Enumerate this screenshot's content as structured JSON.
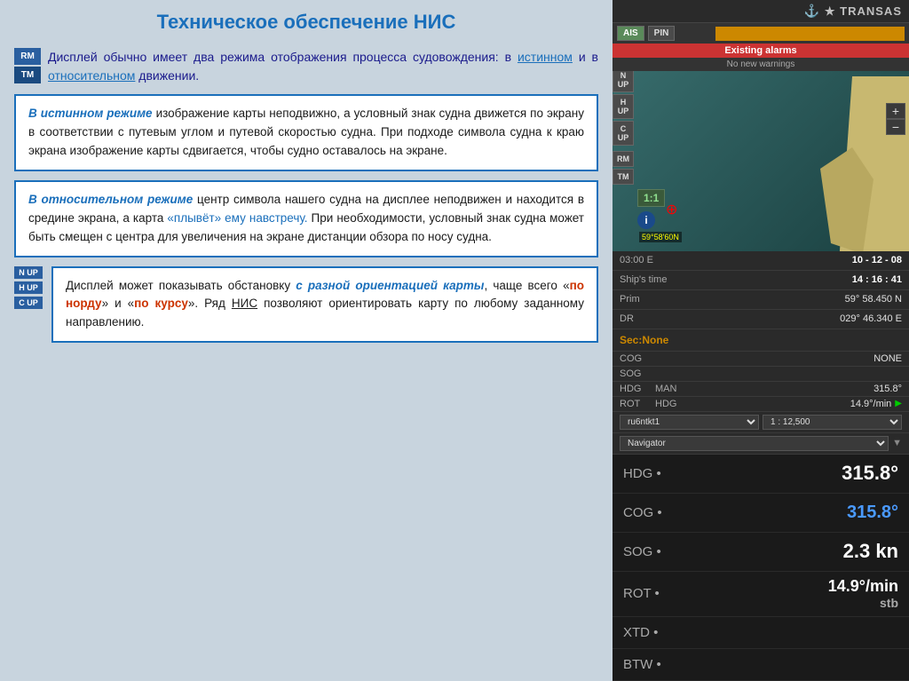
{
  "left": {
    "title": "Техническое обеспечение НИС",
    "intro": {
      "rm_label": "RM",
      "tm_label": "TM",
      "text_part1": "Дисплей обычно имеет два режима отображения процесса судовождения: в ",
      "link1": "истинном",
      "text_part2": " и в ",
      "link2": "относительном",
      "text_part3": " движении."
    },
    "box1": {
      "highlight": "В истинном режиме",
      "text": " изображение карты неподвижно, а условный знак судна движется по экрану в соответствии с путевым углом и путевой скоростью судна. При подходе символа судна к краю экрана изображение карты сдвигается, чтобы судно оставалось на экране."
    },
    "box2": {
      "highlight": "В относительном режиме",
      "text1": " центр символа нашего судна на дисплее неподвижен и находится в средине экрана, а карта ",
      "link": "«плывёт» ему навстречу.",
      "text2": " При необходимости, условный знак судна может быть смещен с центра для увеличения на экране дистанции обзора по носу судна."
    },
    "bottom": {
      "n_label": "N UP",
      "h_label": "H UP",
      "c_label": "C UP",
      "text_intro": "Дисплей может показывать обстановку ",
      "highlight1": "с разной ориентацией карты",
      "text2": ", чаще всего «",
      "link1": "по норду",
      "text3": "» и «",
      "link2": "по курсу",
      "text4": "». Ряд ",
      "underline1": "НИС",
      "text5": " позволяют ориентировать карту по любому заданному направлению."
    }
  },
  "right": {
    "logo": "★ TRANSAS",
    "controls": {
      "ais": "AIS",
      "pin": "PIN",
      "status_bar": "Existing alarms",
      "warning": "No new warnings"
    },
    "nav_side": [
      "▲",
      "N UP",
      "H UP",
      "C UP",
      "RM",
      "TM"
    ],
    "time": {
      "utc_label": "03:00 E",
      "date": "10 - 12 - 08",
      "ships_time_label": "Ship's time",
      "ships_time": "14 : 16 : 41"
    },
    "position": {
      "prim_label": "Prim",
      "prim_value": "59° 58.450 N",
      "dr_label": "DR",
      "dr_value": "029° 46.340 E"
    },
    "sec_none": "Sec:None",
    "cog_label": "COG",
    "cog_value": "NONE",
    "sog_label": "SOG",
    "hdg_label": "HDG",
    "hdg_mode": "MAN",
    "hdg_value": "315.8°",
    "rot_label": "ROT",
    "rot_mode": "HDG",
    "rot_value": "14.9°/min",
    "chart_id": "ru6ntkt1",
    "scale": "1 : 12,500",
    "navigator": "Navigator",
    "big_hdg_label": "HDG •",
    "big_hdg_value": "315.8°",
    "big_cog_label": "COG •",
    "big_cog_value": "315.8°",
    "big_sog_label": "SOG •",
    "big_sog_value": "2.3 kn",
    "big_rot_label": "ROT •",
    "big_rot_value": "14.9°/min",
    "big_rot_sub": "stb",
    "xtd_label": "XTD •",
    "btw_label": "BTW •"
  }
}
